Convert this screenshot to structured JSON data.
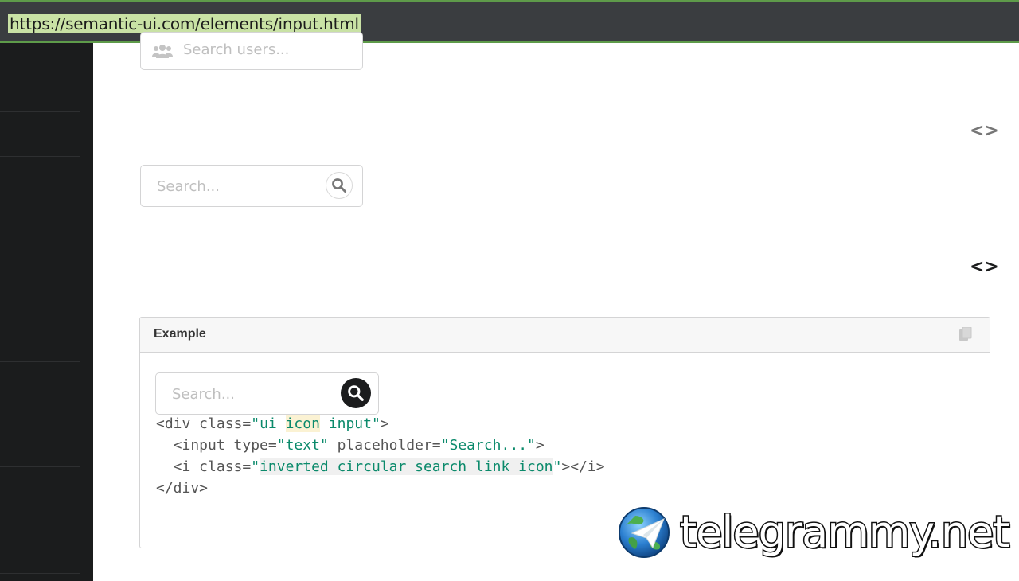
{
  "browser": {
    "url": "https://semantic-ui.com/elements/input.html"
  },
  "examples": {
    "users_search": {
      "placeholder": "Search users...",
      "icon": "users-icon"
    },
    "circular_search": {
      "placeholder": "Search...",
      "icon": "search-icon"
    },
    "code_toggle_glyph": "<>"
  },
  "example_panel": {
    "title": "Example",
    "copy_icon": "copy-icon",
    "input_placeholder": "Search...",
    "code_lines": [
      "<div class=\"ui icon input\">",
      "  <input type=\"text\" placeholder=\"Search...\">",
      "  <i class=\"inverted circular search link icon\"></i>",
      "</div>"
    ]
  },
  "watermark": {
    "text": "telegrammy.net"
  },
  "colors": {
    "url_highlight": "#c9e2a5",
    "sidebar": "#1b1c1d",
    "code_string": "#0b8a6b"
  }
}
